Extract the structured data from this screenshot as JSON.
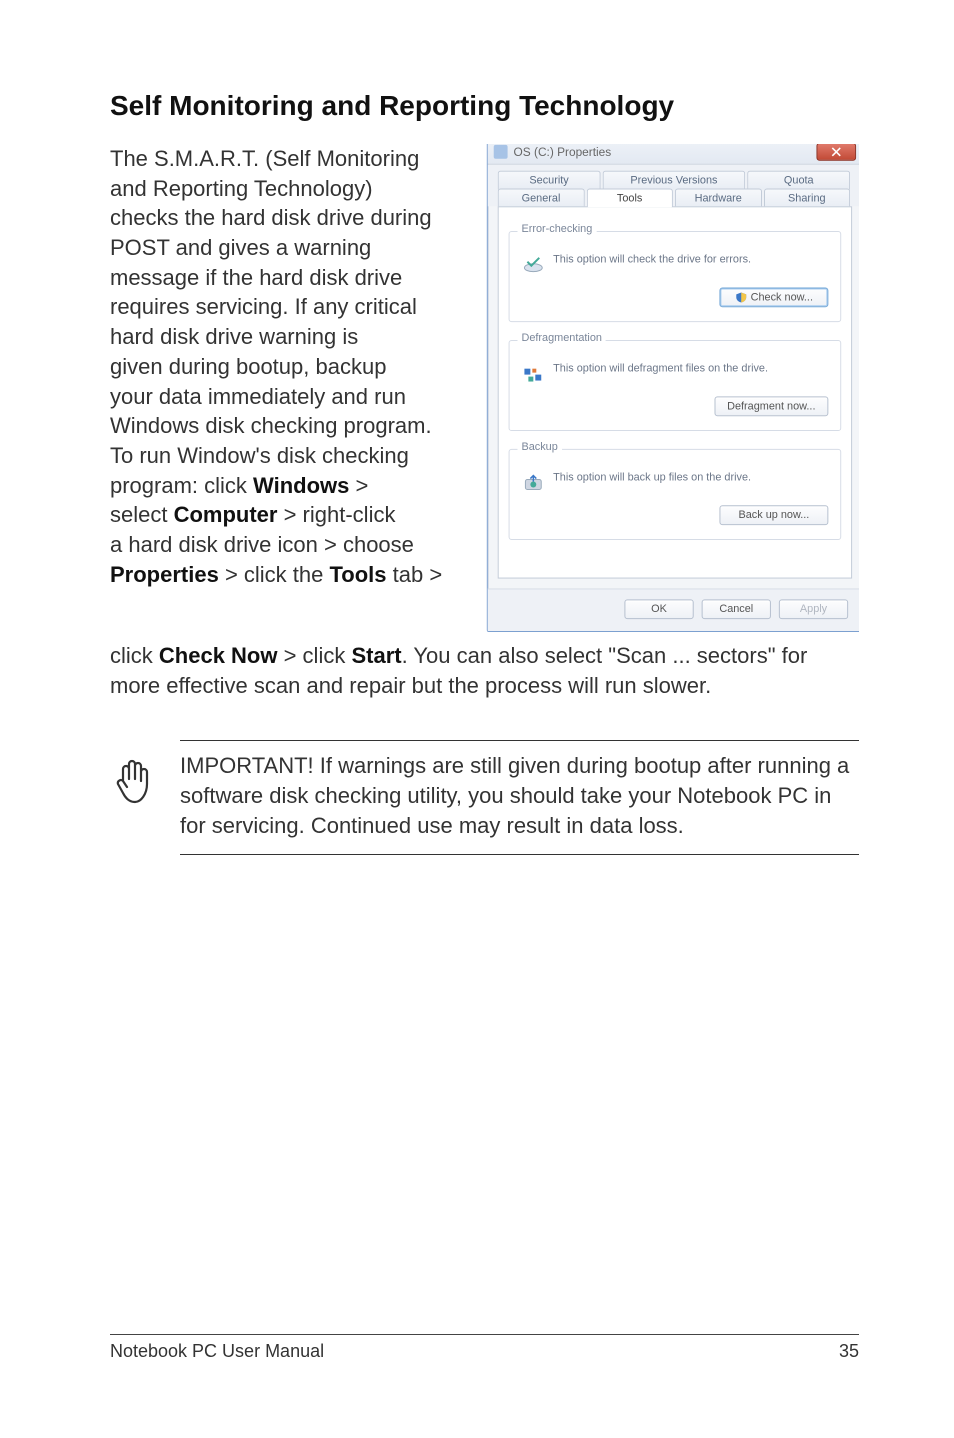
{
  "heading": "Self Monitoring and Reporting Technology",
  "intro_lines": [
    "The S.M.A.R.T. (Self Monitoring",
    "and Reporting Technology)",
    "checks the hard disk drive during",
    "POST and gives a warning",
    "message if the hard disk drive",
    "requires servicing. If any critical",
    "hard disk drive warning is",
    "given during bootup, backup",
    "your data immediately and run",
    "Windows disk checking program.",
    "To run Window's disk checking"
  ],
  "intro_seq": {
    "prefix": "program: click ",
    "b1": "Windows",
    "gt1": " > ",
    "line2a": "select ",
    "b2": "Computer",
    "line2b": " > right-click ",
    "line3": "a hard disk drive icon > choose ",
    "b3": "Properties",
    "line4a": " > click the ",
    "b4": "Tools",
    "line4b": " tab > "
  },
  "continuation": {
    "a": "click ",
    "b1": "Check Now",
    "mid": " > click ",
    "b2": "Start",
    "rest": ". You can also select \"Scan ... sectors\" for more effective scan and repair but the process will run slower."
  },
  "note": "IMPORTANT! If warnings are still given during bootup after running a software disk checking utility, you should take your Notebook PC in for servicing. Continued use may result in data loss.",
  "footer_left": "Notebook PC User Manual",
  "footer_right": "35",
  "dialog": {
    "title": "OS (C:) Properties",
    "tabs_row1": [
      "Security",
      "Previous Versions",
      "Quota"
    ],
    "tabs_row2": [
      "General",
      "Tools",
      "Hardware",
      "Sharing"
    ],
    "active_tab": "Tools",
    "groups": {
      "error": {
        "label": "Error-checking",
        "text": "This option will check the drive for errors.",
        "button": "Check now..."
      },
      "defrag": {
        "label": "Defragmentation",
        "text": "This option will defragment files on the drive.",
        "button": "Defragment now..."
      },
      "backup": {
        "label": "Backup",
        "text": "This option will back up files on the drive.",
        "button": "Back up now..."
      }
    },
    "buttons": {
      "ok": "OK",
      "cancel": "Cancel",
      "apply": "Apply"
    }
  }
}
